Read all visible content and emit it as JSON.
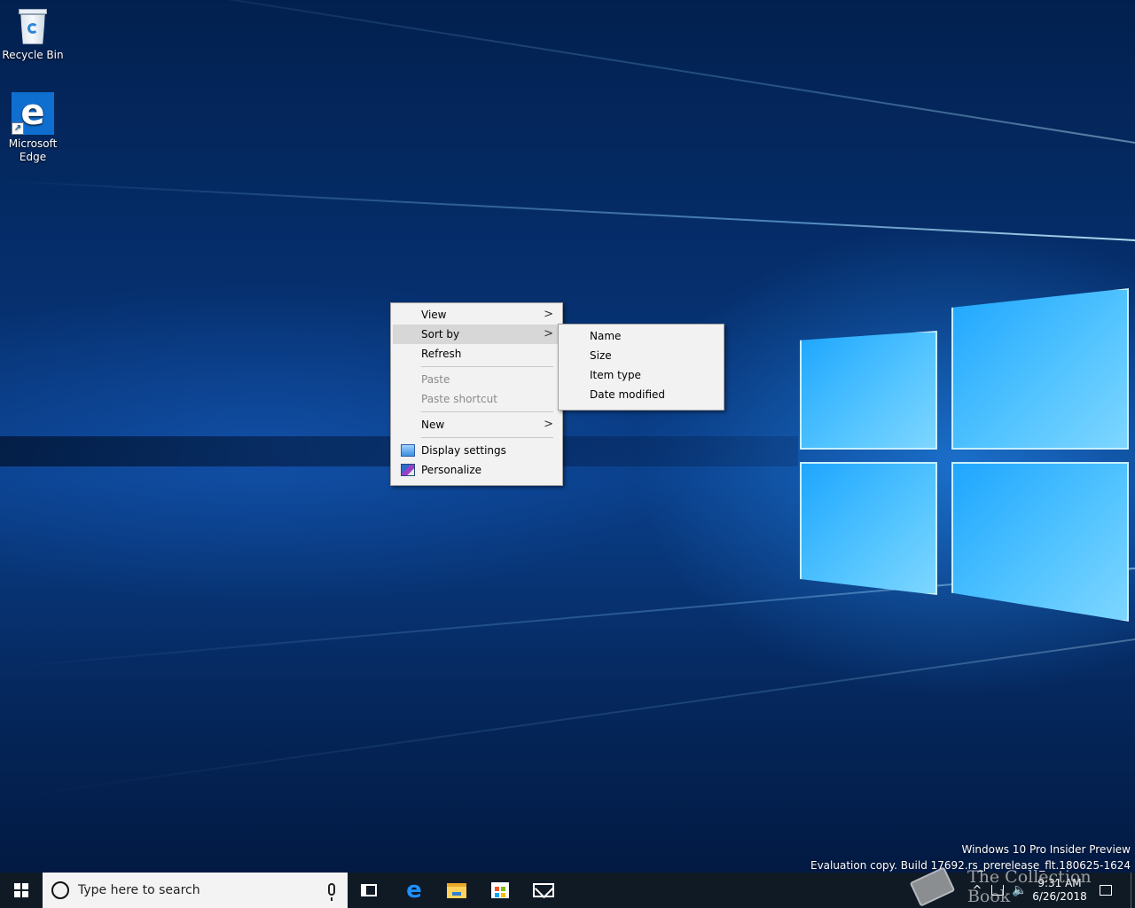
{
  "desktop": {
    "icons": [
      {
        "label": "Recycle Bin",
        "icon": "recycle-bin-icon"
      },
      {
        "label": "Microsoft\nEdge",
        "icon": "edge-icon"
      }
    ],
    "watermark": {
      "line1": "Windows 10 Pro Insider Preview",
      "line2": "Evaluation copy. Build 17692.rs_prerelease_flt.180625-1624"
    }
  },
  "context_menu": {
    "items": [
      {
        "label": "View",
        "submenu": true
      },
      {
        "label": "Sort by",
        "submenu": true,
        "highlighted": true
      },
      {
        "label": "Refresh"
      },
      {
        "label": "Paste",
        "disabled": true
      },
      {
        "label": "Paste shortcut",
        "disabled": true
      },
      {
        "label": "New",
        "submenu": true
      },
      {
        "label": "Display settings",
        "icon": "display-settings-icon"
      },
      {
        "label": "Personalize",
        "icon": "personalize-icon"
      }
    ],
    "submenu_arrow": ">"
  },
  "sort_submenu": {
    "items": [
      "Name",
      "Size",
      "Item type",
      "Date modified"
    ]
  },
  "taskbar": {
    "search_placeholder": "Type here to search",
    "pinned": [
      "task-view-icon",
      "edge-icon",
      "file-explorer-icon",
      "store-icon",
      "mail-icon"
    ],
    "clock": {
      "time": "9:31 AM",
      "date": "6/26/2018"
    },
    "tray": {
      "chevron": "^",
      "volume": "🔈"
    }
  },
  "overlay_watermark": "The Collection Book",
  "colors": {
    "taskbar": "#101a25",
    "menu_bg": "#f2f2f2",
    "menu_highlight": "#d7d7d7",
    "accent": "#0f6fd1"
  }
}
